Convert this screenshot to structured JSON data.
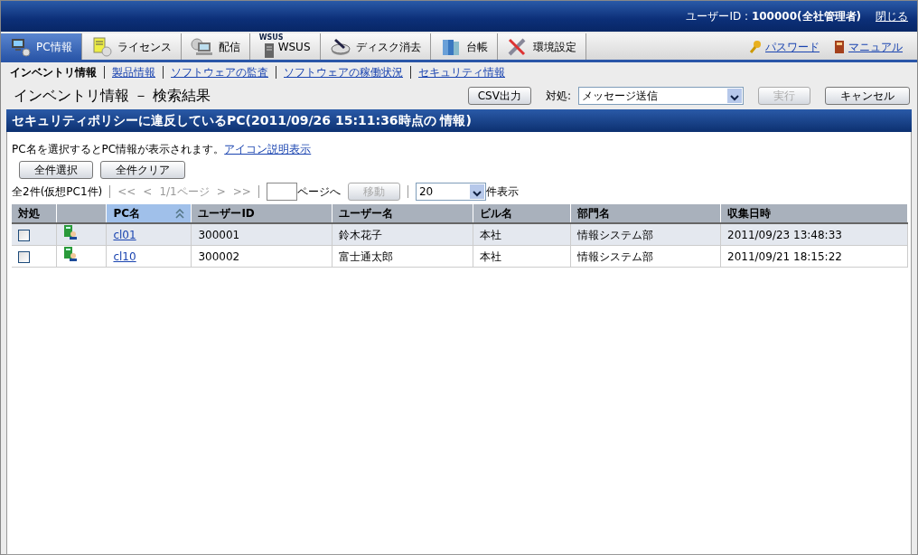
{
  "header": {
    "user": "ユーザーID : **100000(全社管理者)**",
    "logout": "閉じる"
  },
  "tabs": [
    {
      "label": "PC情報",
      "selected": true
    },
    {
      "label": "ライセンス",
      "selected": false
    },
    {
      "label": "配信",
      "selected": false
    },
    {
      "label": "WSUS",
      "selected": false
    },
    {
      "label": "ディスク消去",
      "selected": false
    },
    {
      "label": "台帳",
      "selected": false
    },
    {
      "label": "環境設定",
      "selected": false
    }
  ],
  "tab_icon_caption": "WSUS",
  "right_links": [
    "パスワード",
    "マニュアル"
  ],
  "subnav": [
    {
      "label": "インベントリ情報",
      "selected": true
    },
    {
      "label": "製品情報",
      "selected": false
    },
    {
      "label": "ソフトウェアの監査",
      "selected": false
    },
    {
      "label": "ソフトウェアの稼働状況",
      "selected": false
    },
    {
      "label": "セキュリティ情報",
      "selected": false
    }
  ],
  "page_title": "インベントリ情報 － 検索結果",
  "toolbar": {
    "csv": "CSV出力",
    "action_label": "対処:",
    "action_value": "メッセージ送信",
    "buttons": [
      {
        "label": "実行",
        "disabled": true
      },
      {
        "label": "キャンセル",
        "disabled": false
      }
    ]
  },
  "section_title": "セキュリティポリシーに違反しているPC(2011/09/26 15:11:36時点の 情報)",
  "hint": "PC名を選択するとPC情報が表示されます。",
  "hint_link": "アイコン説明表示",
  "select_buttons": [
    "全件選択",
    "全件クリア"
  ],
  "pager": {
    "count": "全2件(仮想PC1件)",
    "first": "<<",
    "prev": "<",
    "page": "1/1ページ",
    "next": ">",
    "last": ">>",
    "jump_suffix": "ページへ",
    "move": "移動",
    "move_disabled": true,
    "per_page": "20",
    "per_page_suffix": "件表示"
  },
  "table": {
    "columns": [
      {
        "label": "対処",
        "sorted": false
      },
      {
        "sorted": false
      },
      {
        "label": "PC名",
        "sorted": true
      },
      {
        "label": "ユーザーID",
        "sorted": false
      },
      {
        "label": "ユーザー名",
        "sorted": false
      },
      {
        "label": "ビル名",
        "sorted": false
      },
      {
        "label": "部門名",
        "sorted": false
      },
      {
        "label": "収集日時",
        "sorted": false
      }
    ],
    "rows": [
      {
        "cells": [
          {
            "kind": "checkbox",
            "checked": false
          },
          {
            "kind": "icon"
          },
          {
            "kind": "link",
            "text": "cl01"
          },
          {
            "kind": "text",
            "text": "300001"
          },
          {
            "kind": "text",
            "text": "鈴木花子"
          },
          {
            "kind": "text",
            "text": "本社"
          },
          {
            "kind": "text",
            "text": "情報システム部"
          },
          {
            "kind": "text",
            "text": "2011/09/23 13:48:33"
          }
        ]
      },
      {
        "cells": [
          {
            "kind": "checkbox",
            "checked": false
          },
          {
            "kind": "icon"
          },
          {
            "kind": "link",
            "text": "cl10"
          },
          {
            "kind": "text",
            "text": "300002"
          },
          {
            "kind": "text",
            "text": "富士通太郎"
          },
          {
            "kind": "text",
            "text": "本社"
          },
          {
            "kind": "text",
            "text": "情報システム部"
          },
          {
            "kind": "text",
            "text": "2011/09/21 18:15:22"
          }
        ]
      }
    ]
  }
}
